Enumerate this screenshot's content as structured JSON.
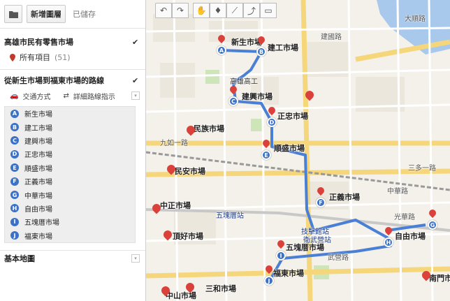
{
  "toolbar": {
    "folder_icon": "folder-icon",
    "new_map_label": "新增圖層",
    "saved_label": "已儲存"
  },
  "layer1": {
    "title": "高雄市民有零售市場",
    "all_items_label": "所有項目",
    "all_items_count": "(51)"
  },
  "route": {
    "title": "從新生市場到福東市場的路線",
    "transport_label": "交通方式",
    "detail_label": "詳細路線指示",
    "stops": [
      {
        "letter": "A",
        "name": "新生市場"
      },
      {
        "letter": "B",
        "name": "建工市場"
      },
      {
        "letter": "C",
        "name": "建興市場"
      },
      {
        "letter": "D",
        "name": "正忠市場"
      },
      {
        "letter": "E",
        "name": "順盛市場"
      },
      {
        "letter": "F",
        "name": "正義市場"
      },
      {
        "letter": "G",
        "name": "中華市場"
      },
      {
        "letter": "H",
        "name": "自由市場"
      },
      {
        "letter": "I",
        "name": "五塊厝市場"
      },
      {
        "letter": "J",
        "name": "福東市場"
      }
    ]
  },
  "basemap": {
    "title": "基本地圖"
  },
  "map_labels": {
    "xinsheng": "新生市場",
    "jiangong": "建工市場",
    "jianxing": "建興市場",
    "zhengzhong": "正忠市場",
    "shunsheng": "順盛市場",
    "minzu": "民族市場",
    "minan": "民安市場",
    "zhengyi": "正義市場",
    "zhongzheng_station": "中正市場",
    "ziyou": "自由市場",
    "wukuaicuo": "五塊厝市場",
    "fudong": "福東市場",
    "dingtian": "頂好市場",
    "sanhe": "三和市場",
    "zhongshan": "中山市場",
    "nanzhong": "南門市",
    "school": "高雄高工",
    "station_wukuai": "五塊厝站",
    "station_jiwu": "技擊館站",
    "station_weiwu": "衛武營站",
    "road_jiuru": "九如一路",
    "road_sanduo": "三多一路",
    "road_zhonghua": "中華路",
    "road_dashun": "大順路",
    "road_jianguo": "建國路",
    "road_guanghua": "光華路",
    "road_wuwei": "武營路"
  }
}
